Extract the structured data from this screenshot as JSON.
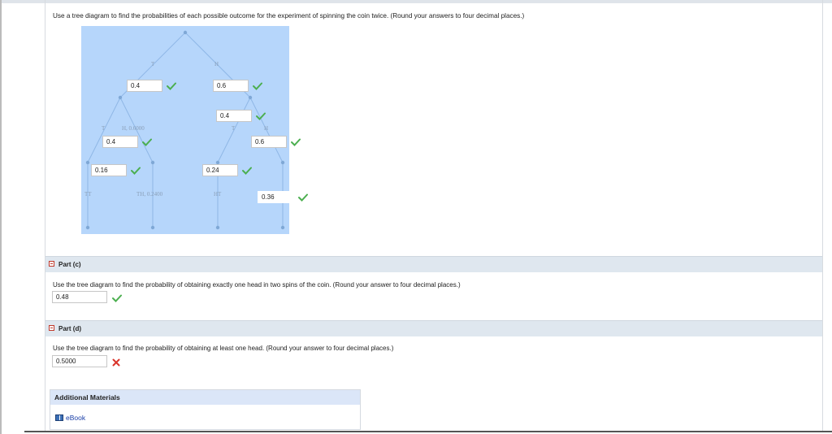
{
  "question": {
    "text": "Use a tree diagram to find the probabilities of each possible outcome for the experiment of spinning the coin twice. (Round your answers to four decimal places.)"
  },
  "tree": {
    "branch_labels": {
      "first_T": "T",
      "first_H": "H",
      "second_T_after_T": "T",
      "second_H_after_T": "H, 0.6000",
      "second_T_after_H": "T",
      "second_H_after_H": "H",
      "outcome_TT": "TT",
      "outcome_TH": "TH, 0.2400",
      "outcome_HT": "HT"
    },
    "answers": {
      "p_first_T": "0.4",
      "p_first_H": "0.6",
      "p_T_given_T": "0.4",
      "p_T_given_H": "0.4",
      "p_H_given_H": "0.6",
      "p_TT": "0.16",
      "p_HT": "0.24",
      "p_HH": "0.36"
    },
    "colors": {
      "background": "#b6d6fb",
      "lines": "#8fb7e6",
      "nodes": "#7fa8d6"
    }
  },
  "part_c": {
    "title": "Part (c)",
    "text": "Use the tree diagram to find the probability of obtaining exactly one head in two spins of the coin. (Round your answer to four decimal places.)",
    "answer": "0.48",
    "status": "correct"
  },
  "part_d": {
    "title": "Part (d)",
    "text": "Use the tree diagram to find the probability of obtaining at least one head. (Round your answer to four decimal places.)",
    "answer": "0.5000",
    "status": "incorrect"
  },
  "materials": {
    "title": "Additional Materials",
    "link": "eBook"
  },
  "icons": {
    "correct": "check-icon",
    "incorrect": "cross-icon",
    "collapse": "minus-box-icon",
    "book": "book-icon"
  },
  "colors": {
    "check": "#4caf50",
    "cross": "#d9342b",
    "link": "#1a3fa8",
    "part_bar": "#dfe7ef"
  }
}
